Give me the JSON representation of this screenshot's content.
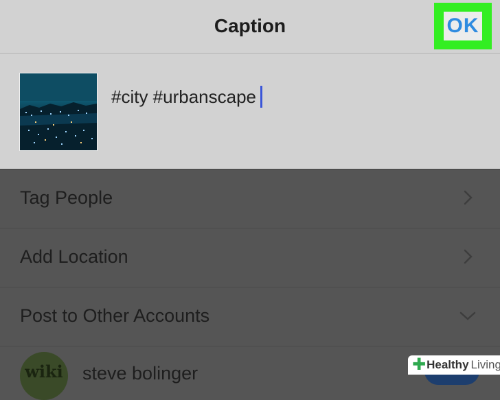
{
  "header": {
    "title": "Caption",
    "ok_label": "OK",
    "highlight_color": "#33ee22"
  },
  "caption": {
    "text": "#city #urbanscape",
    "thumbnail_icon": "city-night-photo"
  },
  "rows": {
    "tag_people": "Tag People",
    "add_location": "Add Location",
    "post_other": "Post to Other Accounts"
  },
  "account": {
    "avatar_text": "wiki",
    "name": "steve bolinger"
  },
  "watermark": {
    "word1": "Healthy",
    "word2": "Living"
  }
}
